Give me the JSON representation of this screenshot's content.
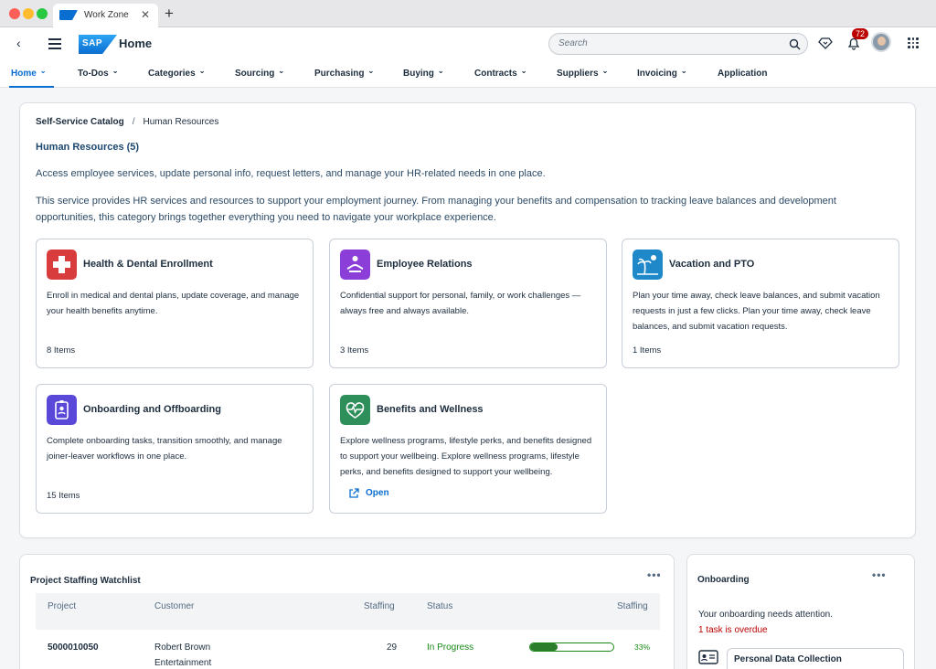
{
  "browser": {
    "tab_title": "Work Zone",
    "close_glyph": "✕",
    "new_tab_glyph": "+"
  },
  "shell": {
    "back_glyph": "‹",
    "logo_text": "SAP",
    "title": "Home",
    "search_placeholder": "Search",
    "notification_count": "72"
  },
  "nav": {
    "items": [
      {
        "label": "Home",
        "dropdown": true,
        "active": true
      },
      {
        "label": "To-Dos",
        "dropdown": true
      },
      {
        "label": "Categories",
        "dropdown": true
      },
      {
        "label": "Sourcing",
        "dropdown": true
      },
      {
        "label": "Purchasing",
        "dropdown": true
      },
      {
        "label": "Buying",
        "dropdown": true
      },
      {
        "label": "Contracts",
        "dropdown": true
      },
      {
        "label": "Suppliers",
        "dropdown": true
      },
      {
        "label": "Invoicing",
        "dropdown": true
      },
      {
        "label": "Application",
        "dropdown": false
      }
    ],
    "chevron_glyph": "⌄"
  },
  "breadcrumb": {
    "root": "Self-Service Catalog",
    "separator": "/",
    "current": "Human Resources"
  },
  "section": {
    "title": "Human Resources (5)",
    "summary": "Access employee services, update personal info, request letters, and manage your HR-related needs in one place.",
    "description": "This service provides HR services and resources to support your employment journey. From managing your benefits and compensation to tracking leave balances and development opportunities, this category brings together everything you need to navigate your workplace experience."
  },
  "services": [
    {
      "name": "Health & Dental Enrollment",
      "description": "Enroll in medical and dental plans, update coverage, and manage your health benefits anytime.",
      "count": "8 Items",
      "icon": "medical-cross-icon",
      "color": "#d93c3c"
    },
    {
      "name": "Employee Relations",
      "description": "Confidential support for personal, family, or work challenges — always free and always available.",
      "count": "3 Items",
      "icon": "person-meditation-icon",
      "color": "#8b3fd8"
    },
    {
      "name": "Vacation and PTO",
      "description": "Plan your time away, check leave balances, and submit vacation requests in just a few clicks. Plan your time away, check leave balances, and submit vacation requests.",
      "count": "1 Items",
      "icon": "palm-tree-sun-icon",
      "color": "#1f88c9"
    },
    {
      "name": "Onboarding and Offboarding",
      "description": "Complete onboarding tasks, transition smoothly, and manage joiner-leaver workflows in one place.",
      "count": "15 Items",
      "icon": "badge-id-icon",
      "color": "#5a48d8"
    },
    {
      "name": "Benefits and Wellness",
      "description": "Explore wellness programs, lifestyle perks, and benefits designed to support your wellbeing. Explore wellness programs, lifestyle perks, and benefits designed to support your wellbeing.",
      "open_label": "Open",
      "icon": "heart-pulse-icon",
      "color": "#2f8f5b"
    }
  ],
  "watchlist": {
    "title": "Project Staffing Watchlist",
    "more_glyph": "•••",
    "columns": [
      "Project",
      "Customer",
      "Staffing",
      "Status",
      "Staffing"
    ],
    "rows": [
      {
        "project": "5000010050",
        "customer_line1": "Robert Brown",
        "customer_line2": "Entertainment",
        "staffing": "29",
        "status": "In Progress",
        "progress": 0.33,
        "percent": "33%"
      }
    ]
  },
  "onboarding": {
    "title": "Onboarding",
    "more_glyph": "•••",
    "message": "Your onboarding needs attention.",
    "alert": "1 task is overdue",
    "task_title": "Personal Data Collection"
  },
  "colors": {
    "accent": "#0a6ed1",
    "success": "#188918",
    "error": "#bb0000"
  }
}
